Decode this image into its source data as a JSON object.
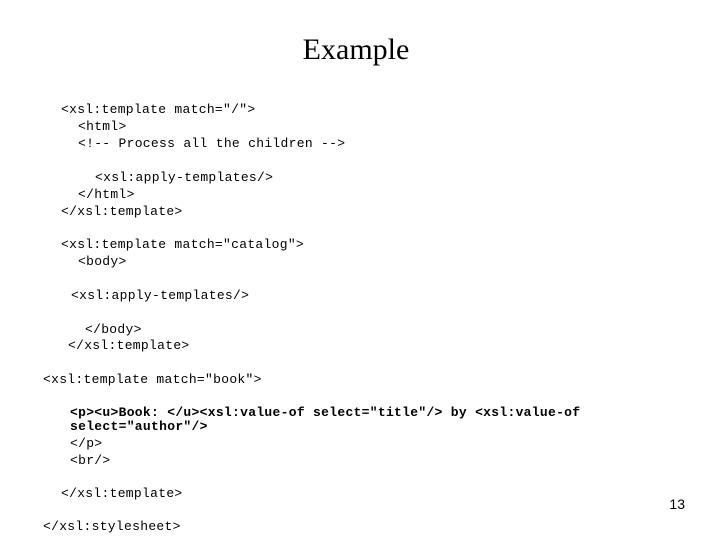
{
  "slide": {
    "title": "Example",
    "page_number": "13",
    "code_lines": [
      "<xsl:template match=\"/\">",
      "<html>",
      "<!-- Process all the children -->",
      "<xsl:apply-templates/>",
      "</html>",
      "</xsl:template>",
      "<xsl:template match=\"catalog\">",
      "<body>",
      "<xsl:apply-templates/>",
      "</body>",
      "</xsl:template>",
      "<xsl:template match=\"book\">",
      "<p><u>Book: </u><xsl:value-of select=\"title\"/> by <xsl:value-of",
      "select=\"author\"/>",
      "</p>",
      "<br/>",
      "</xsl:template>",
      "</xsl:stylesheet>"
    ]
  }
}
